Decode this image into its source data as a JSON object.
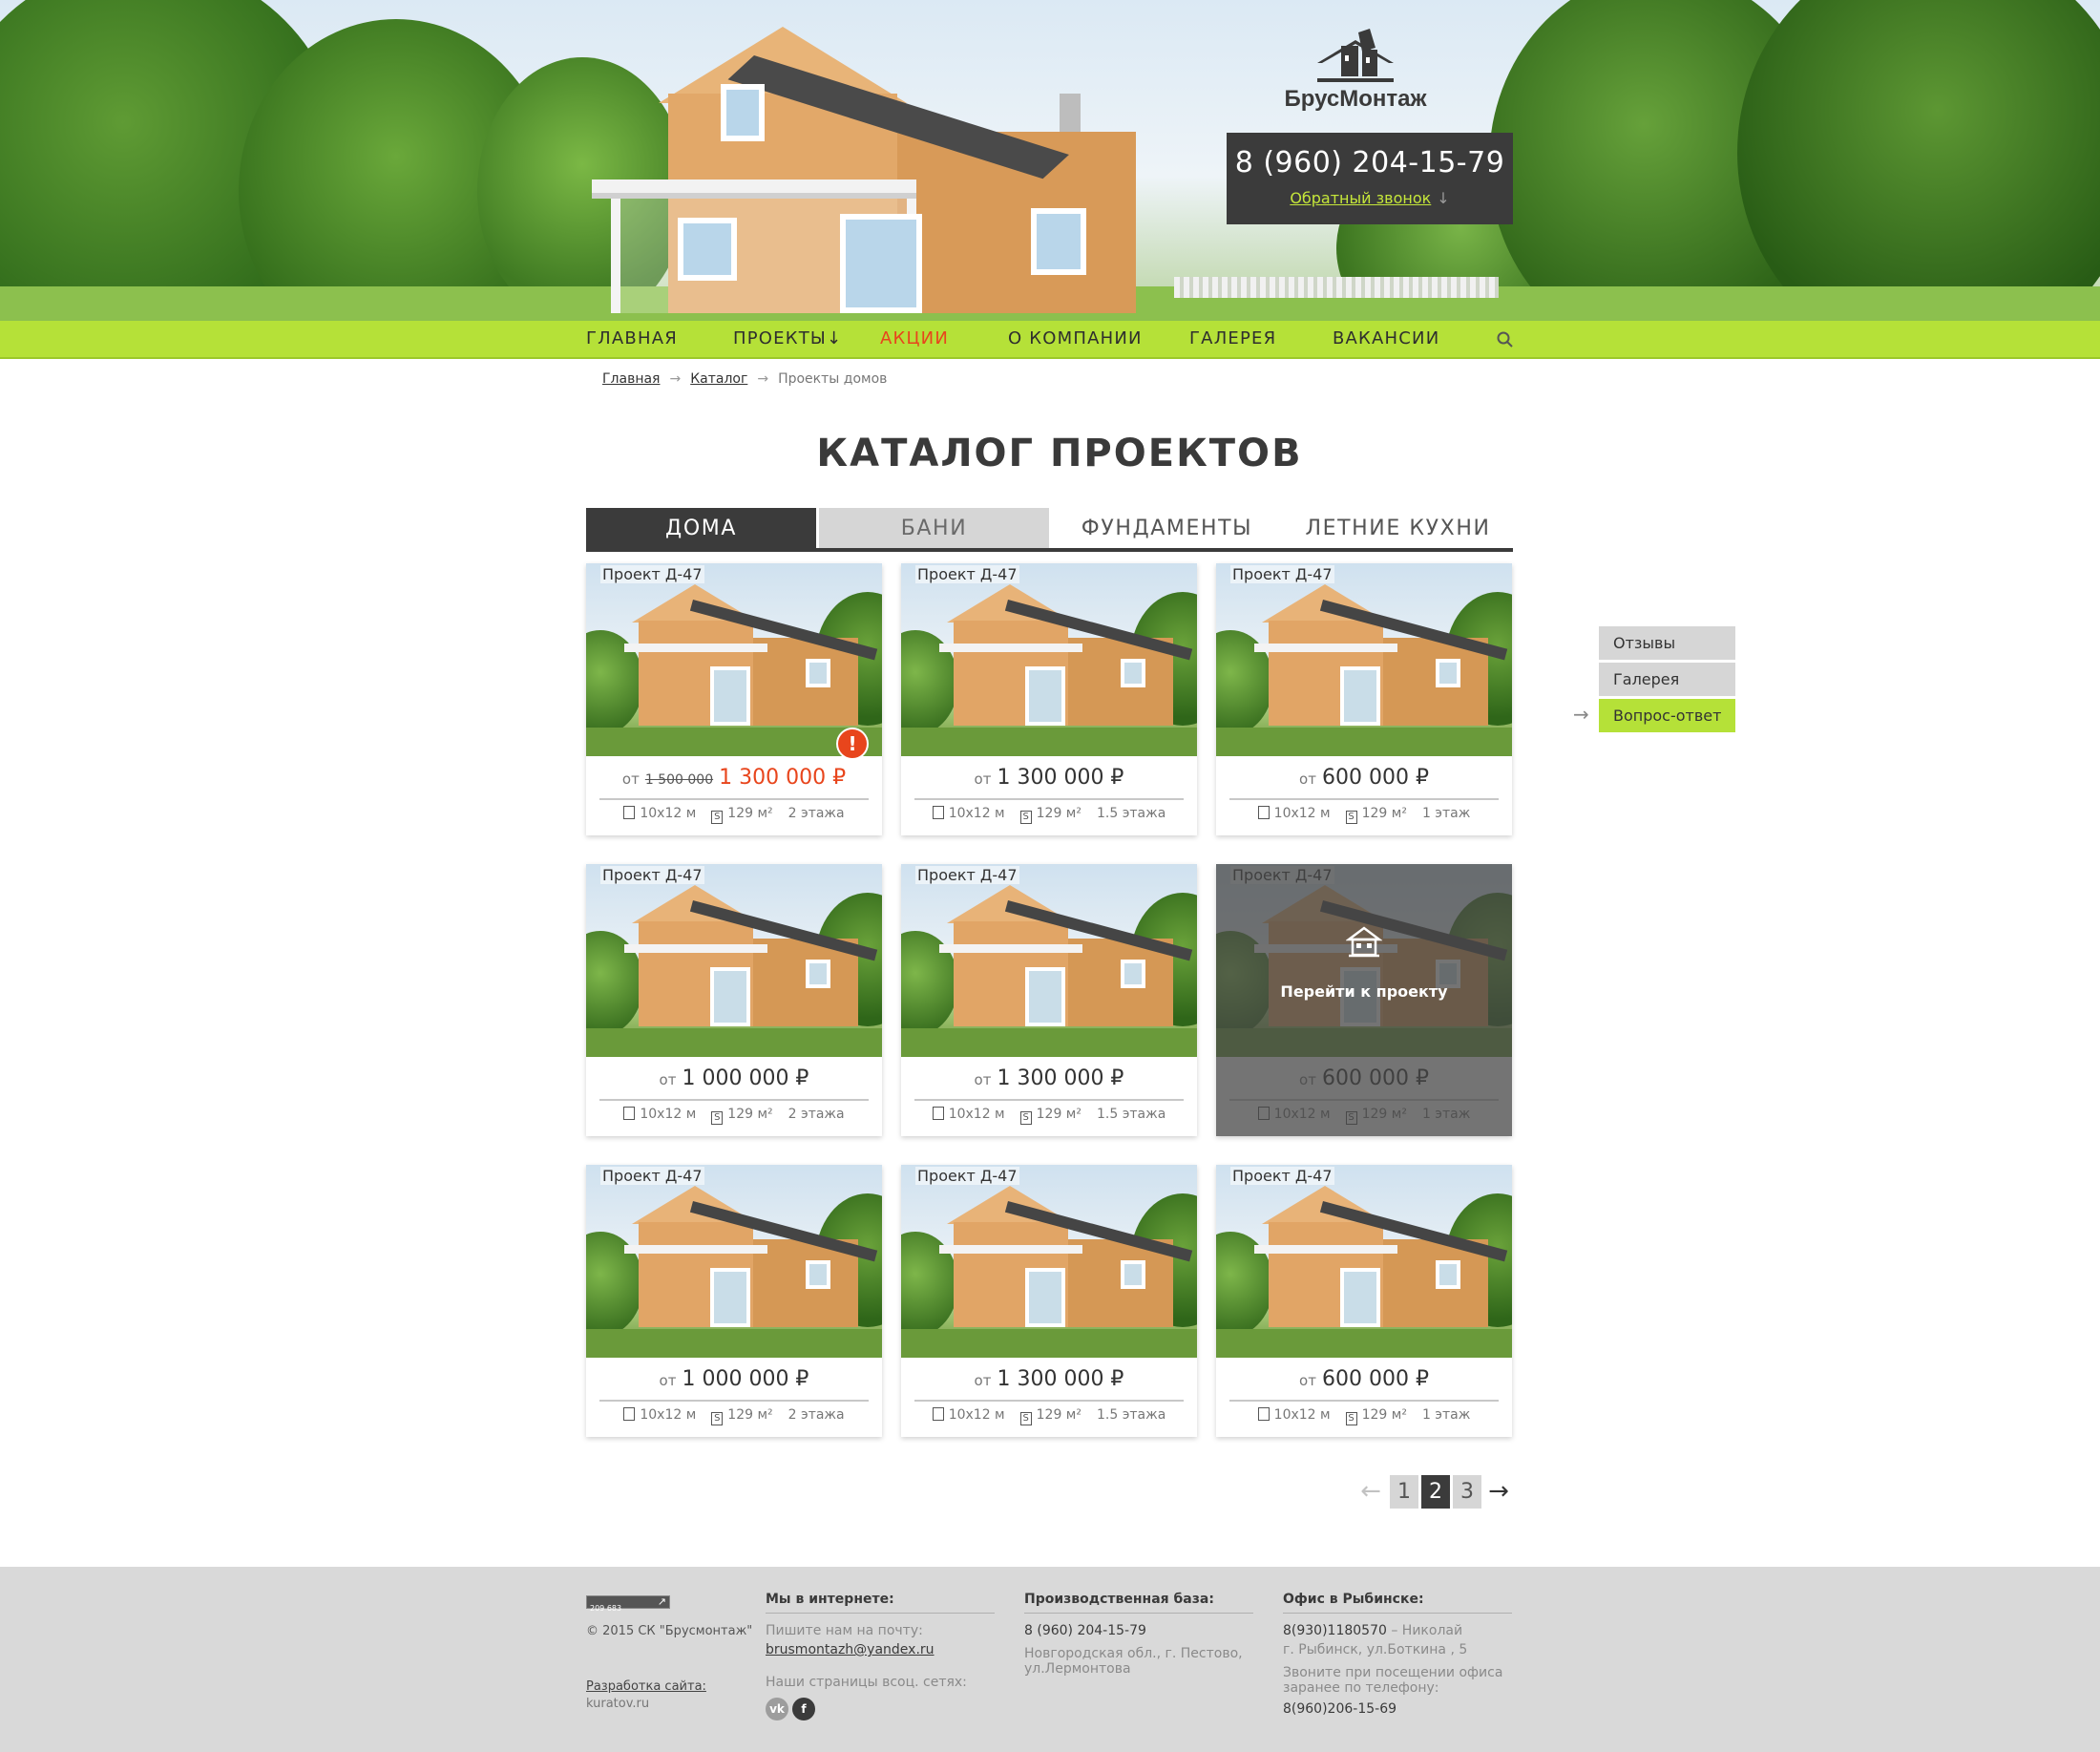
{
  "brand": {
    "name": "БрусМонтаж"
  },
  "header": {
    "phone": "8 (960) 204-15-79",
    "callback_label": "Обратный звонок",
    "callback_arrow": "↓"
  },
  "nav": {
    "items": [
      {
        "label": "ГЛАВНАЯ"
      },
      {
        "label": "ПРОЕКТЫ↓"
      },
      {
        "label": "АКЦИИ"
      },
      {
        "label": "О КОМПАНИИ"
      },
      {
        "label": "ГАЛЕРЕЯ"
      },
      {
        "label": "ВАКАНСИИ"
      }
    ],
    "search_icon": "search-icon",
    "sale_color": "#e8451c",
    "accent_color": "#b5e138"
  },
  "breadcrumb": {
    "home": "Главная",
    "catalog": "Каталог",
    "current": "Проекты домов",
    "separator": "→"
  },
  "page": {
    "title": "КАТАЛОГ ПРОЕКТОВ"
  },
  "tabs": [
    {
      "label": "ДОМА"
    },
    {
      "label": "БАНИ"
    },
    {
      "label": "ФУНДАМЕНТЫ"
    },
    {
      "label": "ЛЕТНИЕ КУХНИ"
    }
  ],
  "cards": [
    {
      "name": "Проект Д-47",
      "from": "от",
      "old_price": "1 500 000",
      "price": "1 300 000 ₽",
      "size": "10x12 м",
      "area": "129 м²",
      "floors": "2 этажа",
      "badge": "!"
    },
    {
      "name": "Проект Д-47",
      "from": "от",
      "price": "1 300 000 ₽",
      "size": "10x12 м",
      "area": "129 м²",
      "floors": "1.5 этажа"
    },
    {
      "name": "Проект Д-47",
      "from": "от",
      "price": "600 000 ₽",
      "size": "10x12 м",
      "area": "129 м²",
      "floors": "1 этаж"
    },
    {
      "name": "Проект Д-47",
      "from": "от",
      "price": "1 000 000 ₽",
      "size": "10x12 м",
      "area": "129 м²",
      "floors": "2 этажа"
    },
    {
      "name": "Проект Д-47",
      "from": "от",
      "price": "1 300 000 ₽",
      "size": "10x12 м",
      "area": "129 м²",
      "floors": "1.5 этажа"
    },
    {
      "name": "Проект Д-47",
      "from": "от",
      "price": "600 000 ₽",
      "size": "10x12 м",
      "area": "129 м²",
      "floors": "1 этаж",
      "hover_label": "Перейти к проекту"
    },
    {
      "name": "Проект Д-47",
      "from": "от",
      "price": "1 000 000 ₽",
      "size": "10x12 м",
      "area": "129 м²",
      "floors": "2 этажа"
    },
    {
      "name": "Проект Д-47",
      "from": "от",
      "price": "1 300 000 ₽",
      "size": "10x12 м",
      "area": "129 м²",
      "floors": "1.5 этажа"
    },
    {
      "name": "Проект Д-47",
      "from": "от",
      "price": "600 000 ₽",
      "size": "10x12 м",
      "area": "129 м²",
      "floors": "1 этаж"
    }
  ],
  "side_menu": {
    "items": [
      {
        "label": "Отзывы"
      },
      {
        "label": "Галерея"
      },
      {
        "label": "Вопрос-ответ"
      }
    ],
    "arrow": "→"
  },
  "pagination": {
    "prev": "←",
    "pages": [
      "1",
      "2",
      "3"
    ],
    "current": "2",
    "next": "→"
  },
  "footer": {
    "counter": "209 683",
    "copyright": "© 2015 СК \"Брусмонтаж\"",
    "dev_label": "Разработка сайта:",
    "dev_site": "kuratov.ru",
    "online": {
      "heading": "Мы в интернете:",
      "mail_label": "Пишите нам на почту:",
      "email": "brusmontazh@yandex.ru",
      "social_label": "Наши страницы всоц. сетях:",
      "vk": "vk",
      "fb": "f"
    },
    "production": {
      "heading": "Производственная база:",
      "phone": "8 (960) 204-15-79",
      "address1": "Новгородская обл., г. Пестово,",
      "address2": "ул.Лермонтова"
    },
    "office": {
      "heading": "Офис в Рыбинске:",
      "phone1": "8(930)1180570",
      "contact": " – Николай",
      "address": "г. Рыбинск, ул.Боткина , 5",
      "note1": "Звоните при посещении офиса",
      "note2": "заранее по телефону:",
      "phone2": "8(960)206-15-69"
    }
  }
}
